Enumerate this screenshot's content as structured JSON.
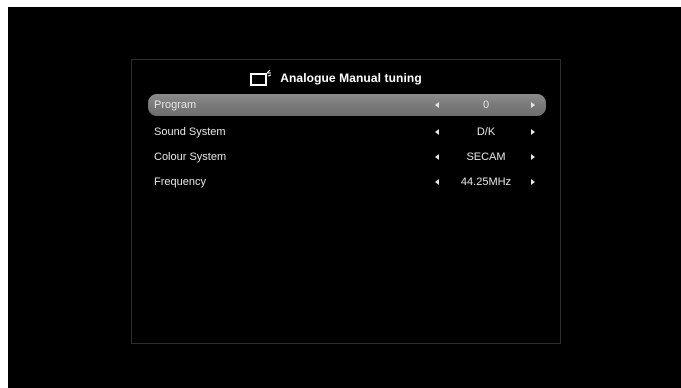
{
  "header": {
    "title": "Analogue Manual tuning",
    "icon": "tv-icon"
  },
  "menu": {
    "items": [
      {
        "label": "Program",
        "value": "0",
        "selected": true
      },
      {
        "label": "Sound System",
        "value": "D/K",
        "selected": false
      },
      {
        "label": "Colour System",
        "value": "SECAM",
        "selected": false
      },
      {
        "label": "Frequency",
        "value": "44.25MHz",
        "selected": false
      }
    ]
  },
  "colors": {
    "background": "#000000",
    "highlight": "#7a7a7a",
    "text": "#e6e6e6"
  }
}
